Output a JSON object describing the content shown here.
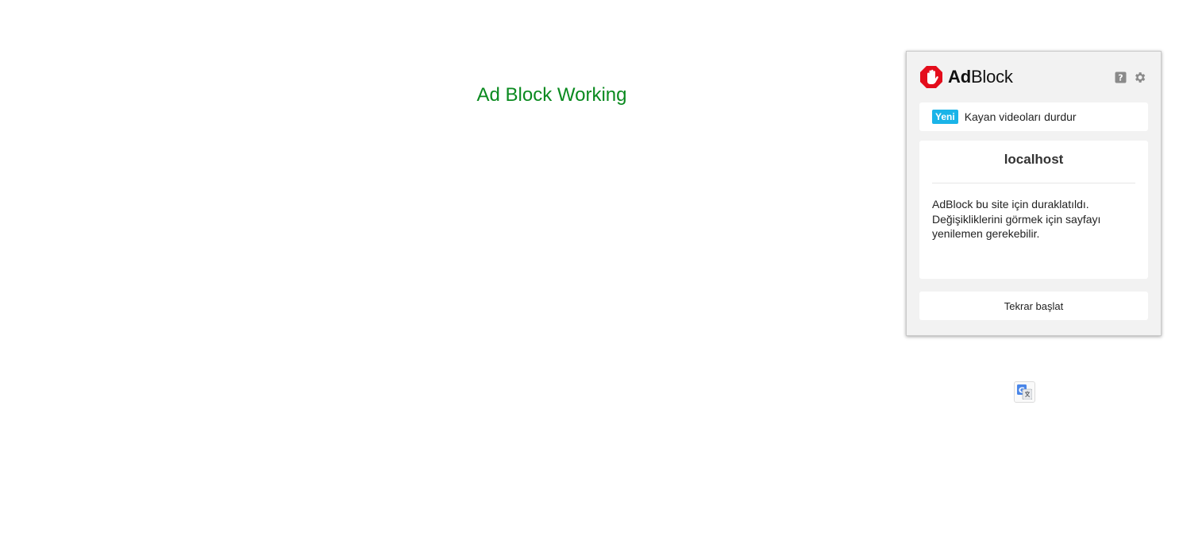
{
  "page": {
    "status_text": "Ad Block Working",
    "status_color": "#0a8a1f"
  },
  "popup": {
    "logo": {
      "name": "adblock-logo-icon",
      "text_bold": "Ad",
      "text_regular": "Block",
      "brand_color": "#e40d1c"
    },
    "header_icons": [
      "help-icon",
      "gear-icon"
    ],
    "news": {
      "badge": "Yeni",
      "badge_color": "#1ab4e8",
      "text": "Kayan videoları durdur"
    },
    "site": {
      "domain": "localhost",
      "message_lines": [
        "AdBlock bu site için duraklatıldı.",
        "Değişikliklerini görmek için sayfayı",
        "yenilemen gerekebilir."
      ]
    },
    "resume_label": "Tekrar başlat"
  },
  "translate_icon": "google-translate-icon"
}
